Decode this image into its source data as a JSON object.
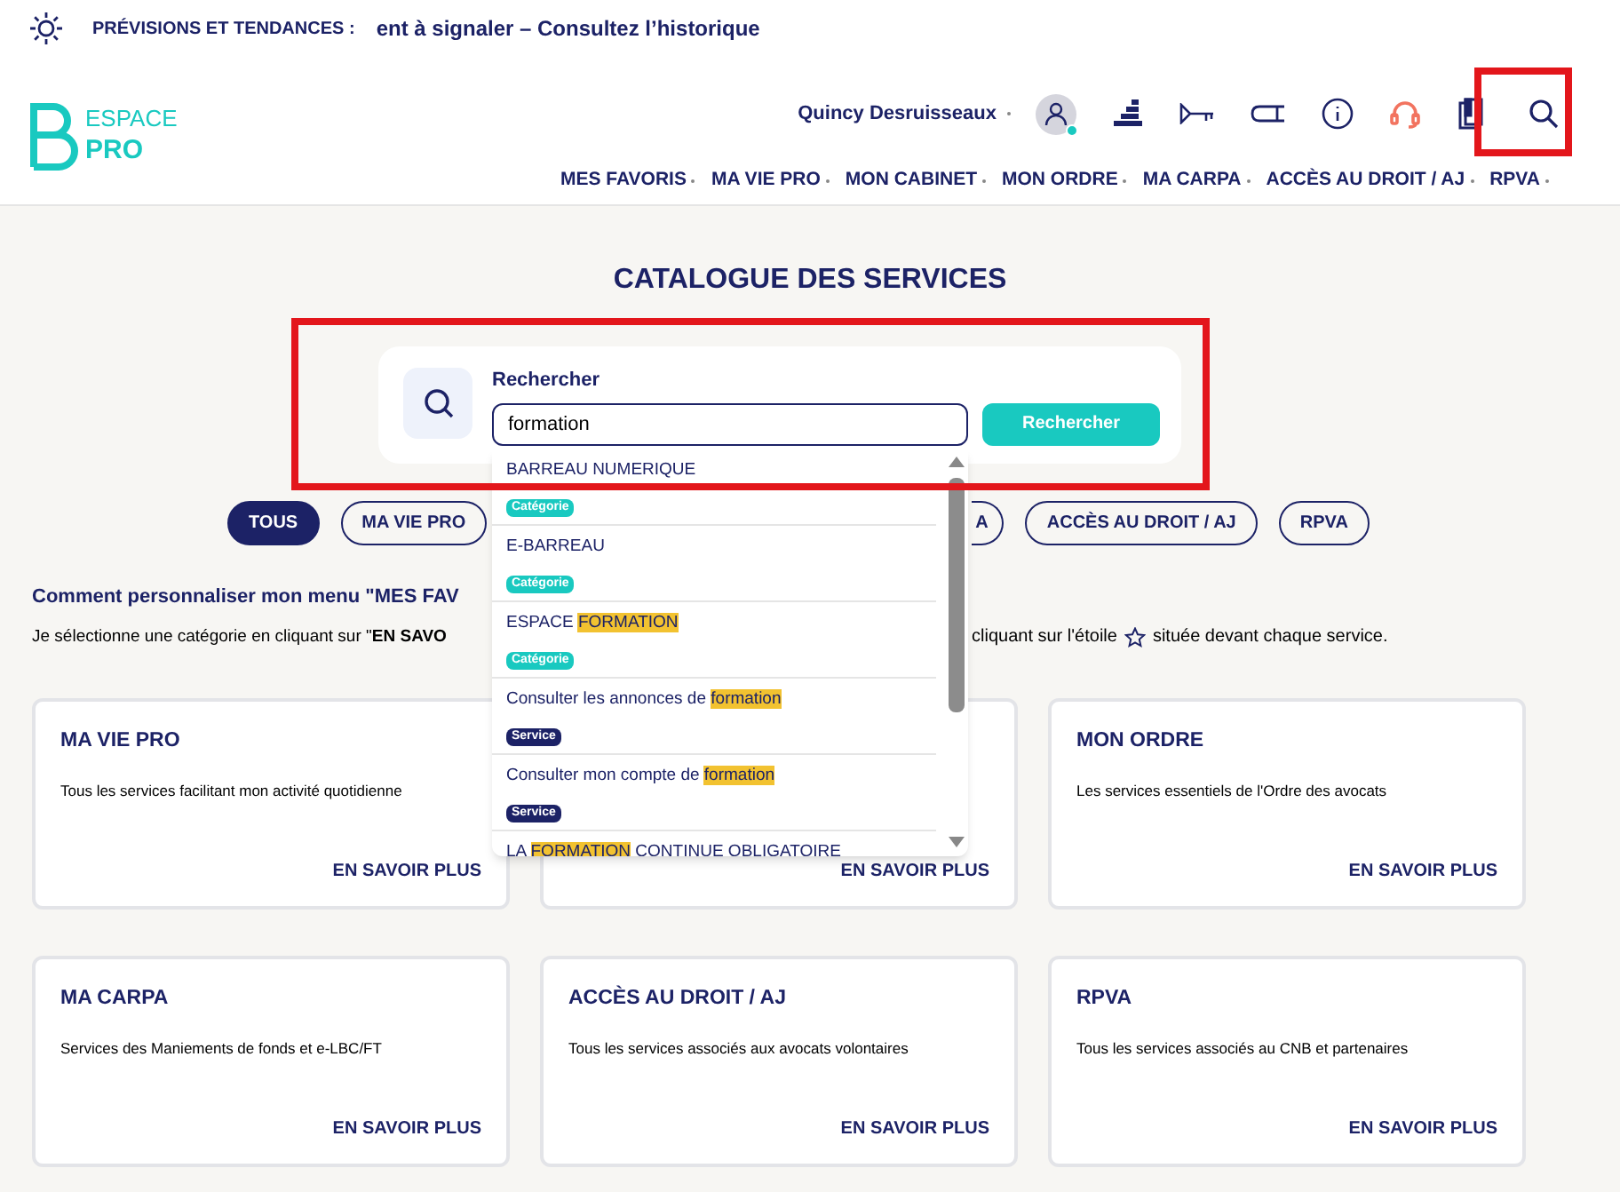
{
  "top_strip": {
    "label": "PRÉVISIONS ET TENDANCES :",
    "message": "ent à signaler – Consultez l’historique"
  },
  "logo": {
    "line_1": "ESPACE",
    "line_2": "PRO"
  },
  "user": {
    "name": "Quincy Desruisseaux",
    "online": true
  },
  "nav": [
    "MES FAVORIS",
    "MA VIE PRO",
    "MON CABINET",
    "MON ORDRE",
    "MA CARPA",
    "ACCÈS AU DROIT / AJ",
    "RPVA"
  ],
  "page_title": "CATALOGUE DES SERVICES",
  "search": {
    "label": "Rechercher",
    "value": "formation",
    "button": "Rechercher"
  },
  "suggestions": [
    {
      "parts": [
        {
          "text": "BARREAU NUMERIQUE",
          "highlighted": false
        }
      ],
      "badge": {
        "label": "Catégorie",
        "kind": "category"
      }
    },
    {
      "parts": [
        {
          "text": "E-BARREAU",
          "highlighted": false
        }
      ],
      "badge": {
        "label": "Catégorie",
        "kind": "category"
      }
    },
    {
      "parts": [
        {
          "text": "ESPACE ",
          "highlighted": false
        },
        {
          "text": "FORMATION",
          "highlighted": true
        }
      ],
      "badge": {
        "label": "Catégorie",
        "kind": "category"
      }
    },
    {
      "parts": [
        {
          "text": "Consulter les annonces de ",
          "highlighted": false
        },
        {
          "text": "formation",
          "highlighted": true
        }
      ],
      "badge": {
        "label": "Service",
        "kind": "service"
      }
    },
    {
      "parts": [
        {
          "text": "Consulter mon compte de ",
          "highlighted": false
        },
        {
          "text": "formation",
          "highlighted": true
        }
      ],
      "badge": {
        "label": "Service",
        "kind": "service"
      }
    },
    {
      "parts": [
        {
          "text": "LA ",
          "highlighted": false
        },
        {
          "text": "FORMATION",
          "highlighted": true
        },
        {
          "text": " CONTINUE OBLIGATOIRE",
          "highlighted": false
        }
      ]
    }
  ],
  "filters": [
    {
      "label": "TOUS",
      "selected": true
    },
    {
      "label": "MA VIE PRO",
      "selected": false
    },
    {
      "label": "A",
      "selected": false
    },
    {
      "label": "ACCÈS AU DROIT / AJ",
      "selected": false
    },
    {
      "label": "RPVA",
      "selected": false
    }
  ],
  "help": {
    "heading": "Comment personnaliser mon menu \"MES FAV",
    "line_start": "Je sélectionne une catégorie en cliquant sur \"**EN SAVO**",
    "line_end_before_star": "cliquant sur l'étoile",
    "line_end_after_star": "située devant chaque service."
  },
  "cards": [
    {
      "title": "MA VIE PRO",
      "description": "Tous les services facilitant mon activité quotidienne",
      "link": "EN SAVOIR PLUS"
    },
    {
      "link": "EN SAVOIR PLUS"
    },
    {
      "title": "MON ORDRE",
      "description": "Les services essentiels de l'Ordre des avocats",
      "link": "EN SAVOIR PLUS"
    },
    {
      "title": "MA CARPA",
      "description": "Services des Maniements de fonds et e-LBC/FT",
      "link": "EN SAVOIR PLUS"
    },
    {
      "title": "ACCÈS AU DROIT / AJ",
      "description": "Tous les services associés aux avocats volontaires",
      "link": "EN SAVOIR PLUS"
    },
    {
      "title": "RPVA",
      "description": "Tous les services associés au CNB et partenaires",
      "link": "EN SAVOIR PLUS"
    }
  ]
}
